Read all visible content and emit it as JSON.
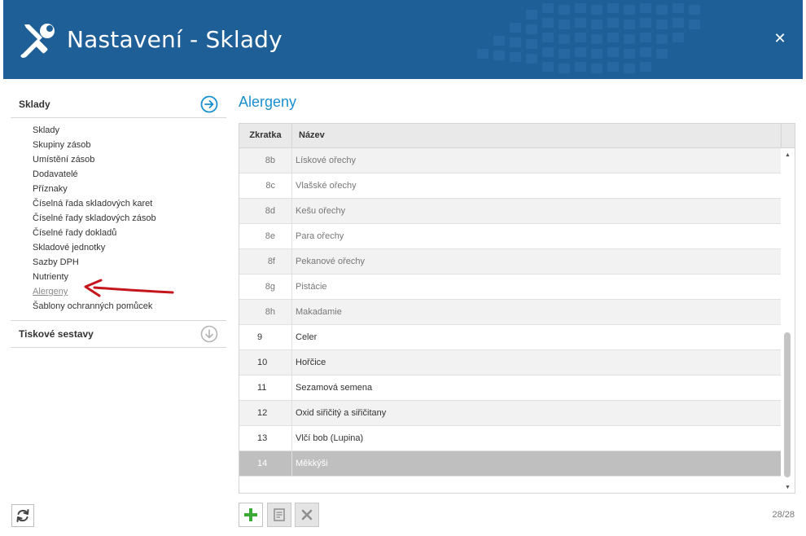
{
  "window": {
    "title": "Nastavení - Sklady",
    "close_icon": "close-icon",
    "title_icon": "tools-icon",
    "header_color": "#1f5f98"
  },
  "sidebar": {
    "sections": [
      {
        "label": "Sklady",
        "icon": "arrow-right-circle-icon",
        "items": [
          {
            "label": "Sklady"
          },
          {
            "label": "Skupiny zásob"
          },
          {
            "label": "Umístění zásob"
          },
          {
            "label": "Dodavatelé"
          },
          {
            "label": "Příznaky"
          },
          {
            "label": "Číselná řada skladových karet"
          },
          {
            "label": "Číselné řady skladových zásob"
          },
          {
            "label": "Číselné řady dokladů"
          },
          {
            "label": "Skladové jednotky"
          },
          {
            "label": "Sazby DPH"
          },
          {
            "label": "Nutrienty"
          },
          {
            "label": "Alergeny",
            "active": true
          },
          {
            "label": "Šablony ochranných pomůcek"
          }
        ]
      },
      {
        "label": "Tiskové sestavy",
        "icon": "arrow-down-circle-icon"
      }
    ],
    "refresh_icon": "refresh-icon"
  },
  "content": {
    "title": "Alergeny",
    "accent_color": "#1a8fd0",
    "table": {
      "columns": [
        "Zkratka",
        "Název"
      ],
      "rows": [
        {
          "code": "8b",
          "name": "Lískové ořechy",
          "level": "child"
        },
        {
          "code": "8c",
          "name": "Vlašské ořechy",
          "level": "child"
        },
        {
          "code": "8d",
          "name": "Kešu ořechy",
          "level": "child"
        },
        {
          "code": "8e",
          "name": "Para ořechy",
          "level": "child"
        },
        {
          "code": "8f",
          "name": "Pekanové ořechy",
          "level": "child"
        },
        {
          "code": "8g",
          "name": "Pistácie",
          "level": "child"
        },
        {
          "code": "8h",
          "name": "Makadamie",
          "level": "child"
        },
        {
          "code": "9",
          "name": "Celer",
          "level": "top"
        },
        {
          "code": "10",
          "name": "Hořčice",
          "level": "top"
        },
        {
          "code": "11",
          "name": "Sezamová semena",
          "level": "top"
        },
        {
          "code": "12",
          "name": "Oxid siřičitý a siřičitany",
          "level": "top"
        },
        {
          "code": "13",
          "name": "Vlčí bob (Lupina)",
          "level": "top"
        },
        {
          "code": "14",
          "name": "Měkkýši",
          "level": "top",
          "selected": true
        }
      ]
    },
    "toolbar": {
      "add_icon": "plus-icon",
      "edit_icon": "edit-icon",
      "delete_icon": "delete-icon"
    },
    "counter": "28/28"
  }
}
